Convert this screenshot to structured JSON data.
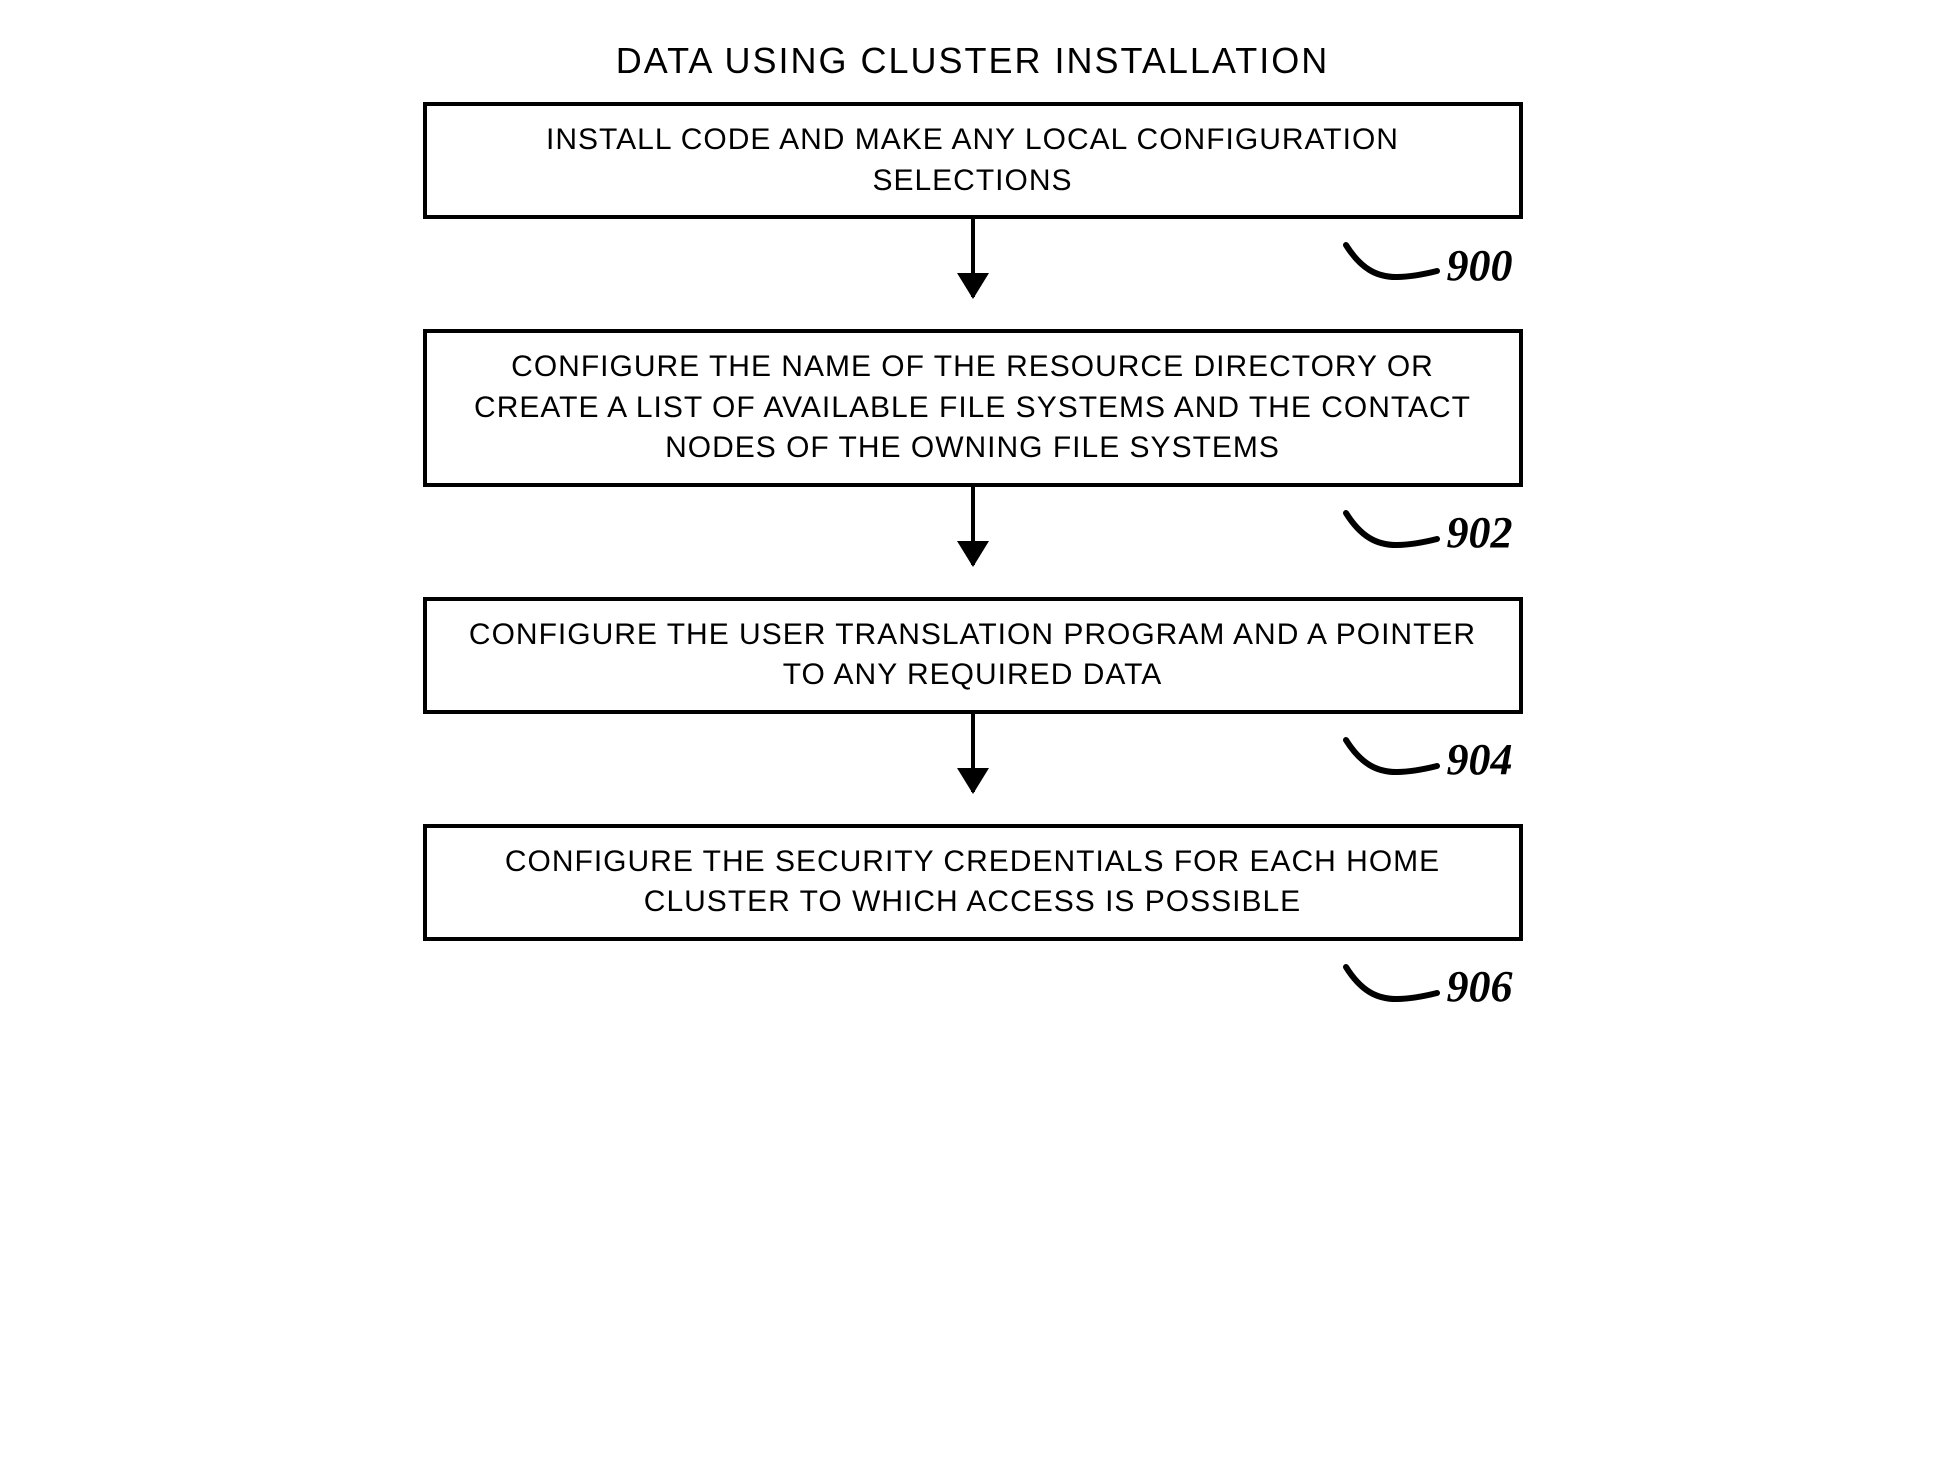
{
  "title": "DATA USING CLUSTER INSTALLATION",
  "steps": [
    {
      "text": "INSTALL CODE AND MAKE ANY LOCAL CONFIGURATION SELECTIONS",
      "ref": "900"
    },
    {
      "text": "CONFIGURE THE NAME OF THE RESOURCE DIRECTORY OR CREATE A LIST OF AVAILABLE FILE SYSTEMS AND THE CONTACT NODES OF THE OWNING FILE SYSTEMS",
      "ref": "902"
    },
    {
      "text": "CONFIGURE THE USER TRANSLATION PROGRAM AND A POINTER TO ANY REQUIRED DATA",
      "ref": "904"
    },
    {
      "text": "CONFIGURE THE SECURITY CREDENTIALS FOR EACH HOME CLUSTER TO WHICH ACCESS IS POSSIBLE",
      "ref": "906"
    }
  ]
}
